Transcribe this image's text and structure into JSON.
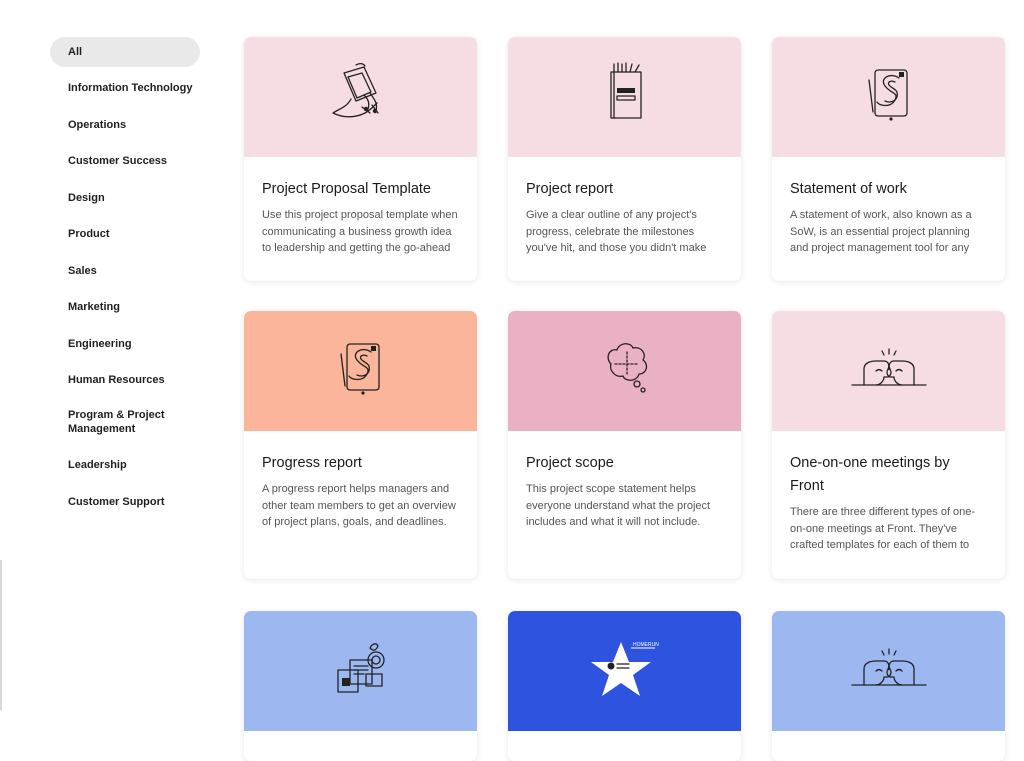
{
  "sidebar": {
    "items": [
      {
        "label": "All",
        "active": true
      },
      {
        "label": "Information Technology"
      },
      {
        "label": "Operations"
      },
      {
        "label": "Customer Success"
      },
      {
        "label": "Design"
      },
      {
        "label": "Product"
      },
      {
        "label": "Sales"
      },
      {
        "label": "Marketing"
      },
      {
        "label": "Engineering"
      },
      {
        "label": "Human Resources"
      },
      {
        "label": "Program & Project Management"
      },
      {
        "label": "Leadership"
      },
      {
        "label": "Customer Support"
      }
    ]
  },
  "cards": [
    {
      "title": "Project Proposal Template",
      "description": "Use this project proposal template when communicating a business growth idea to leadership and getting the go-ahead to get this project",
      "thumb_color": "#f6dde3",
      "icon": "tablet-hand-icon"
    },
    {
      "title": "Project report",
      "description": "Give a clear outline of any project's progress, celebrate the milestones you've hit, and those you didn't make progress with as a team.",
      "thumb_color": "#f6dde3",
      "icon": "notebook-icon"
    },
    {
      "title": "Statement of work",
      "description": "A statement of work, also known as a SoW, is an essential project planning and project management tool for any agile deliverables.",
      "thumb_color": "#f6dde3",
      "icon": "board-game-icon"
    },
    {
      "title": "Progress report",
      "description": "A progress report helps managers and other team members to get an overview of project plans, goals, and deadlines.",
      "thumb_color": "#fab59a",
      "icon": "board-game-icon"
    },
    {
      "title": "Project scope",
      "description": "This project scope statement helps everyone understand what the project includes and what it will not include.",
      "thumb_color": "#eab0c3",
      "icon": "thought-bubble-icon"
    },
    {
      "title": "One-on-one meetings by Front",
      "description": "There are three different types of one-on-one meetings at Front. They've crafted templates for each of them to use.",
      "thumb_color": "#f6dde3",
      "icon": "fist-bump-icon"
    },
    {
      "title": "",
      "description": "",
      "thumb_color": "#9db8f0",
      "icon": "collage-icon"
    },
    {
      "title": "",
      "description": "",
      "thumb_color": "#2d53df",
      "icon": "star-badge-icon",
      "badge_text": "HOMERUN"
    },
    {
      "title": "",
      "description": "",
      "thumb_color": "#9db8f0",
      "icon": "fist-bump-icon"
    }
  ]
}
